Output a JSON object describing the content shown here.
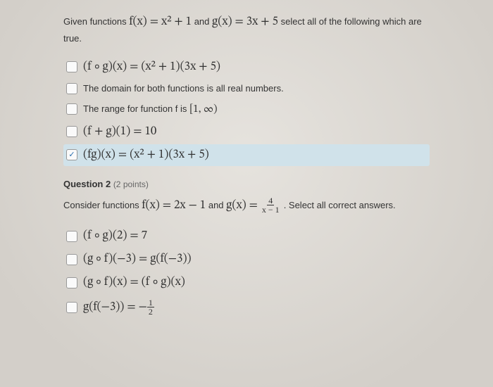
{
  "q1": {
    "prompt_pre": "Given functions ",
    "f_def": "f(x) = x² + 1",
    "mid": " and ",
    "g_def": "g(x) = 3x + 5",
    "prompt_post": " select all of the following which are true.",
    "options": [
      {
        "checked": false,
        "label_math": "(f ∘ g)(x) = (x² + 1)(3x + 5)"
      },
      {
        "checked": false,
        "label_text": "The domain for both functions is all real numbers."
      },
      {
        "checked": false,
        "label_mix_pre": "The range for function f is ",
        "label_mix_math": "[1, ∞)"
      },
      {
        "checked": false,
        "label_math": "(f + g)(1) = 10"
      },
      {
        "checked": true,
        "label_math": "(fg)(x) = (x² + 1)(3x + 5)"
      }
    ]
  },
  "q2": {
    "heading": "Question 2",
    "points": "(2 points)",
    "prompt_pre": "Consider functions ",
    "f_def": "f(x) = 2x − 1",
    "mid": " and ",
    "g_def_pre": "g(x) = ",
    "g_frac_num": "4",
    "g_frac_den": "x − 1",
    "prompt_post": ". Select all correct answers.",
    "options": [
      {
        "label_math": "(f ∘ g)(2) = 7"
      },
      {
        "label_math": "(g ∘ f)(−3) = g(f(−3))"
      },
      {
        "label_math": "(g ∘ f)(x) = (f ∘ g)(x)"
      },
      {
        "label_math_pre": "g(f(−3)) = −",
        "frac_num": "1",
        "frac_den": "2"
      }
    ]
  }
}
